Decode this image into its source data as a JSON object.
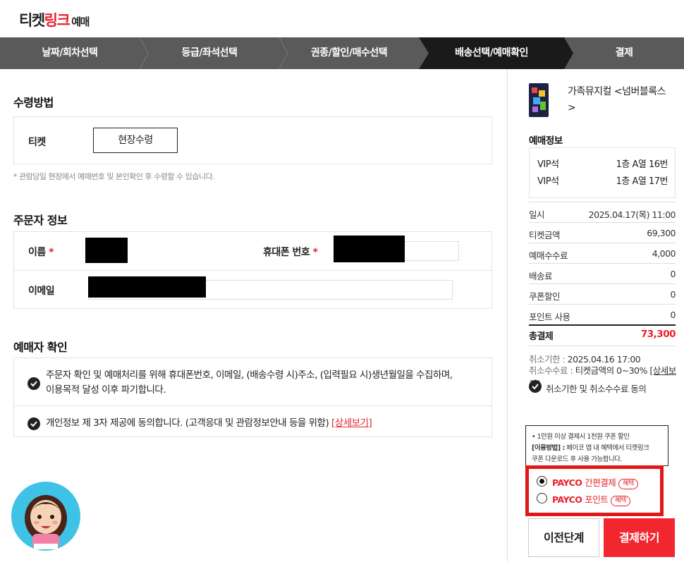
{
  "header": {
    "logo_part1": "티켓",
    "logo_part2": "링크",
    "logo_part3": "예매"
  },
  "steps": [
    {
      "label": "날짜/회차선택"
    },
    {
      "label": "등급/좌석선택"
    },
    {
      "label": "권종/할인/매수선택"
    },
    {
      "label": "배송선택/예매확인",
      "active": true
    },
    {
      "label": "결제"
    }
  ],
  "delivery": {
    "title": "수령방법",
    "ticket_label": "티켓",
    "option": "현장수령",
    "note": "* 관람당일 현장에서 예매번호 및 본인확인 후 수령할 수 있습니다."
  },
  "orderer": {
    "title": "주문자 정보",
    "name_label": "이름",
    "phone_label": "휴대폰 번호",
    "email_label": "이메일",
    "required_mark": "*"
  },
  "confirm": {
    "title": "예매자 확인",
    "item1_line1": "주문자 확인 및 예매처리를 위해 휴대폰번호, 이메일, (배송수령 시)주소, (입력필요 시)생년월일을 수집하며,",
    "item1_line2": "이용목적 달성 이후 파기합니다.",
    "item2_text": "개인정보 제 3자 제공에 동의합니다. (고객응대 및 관람정보안내 등을 위함)",
    "item2_link": "[상세보기]"
  },
  "summary": {
    "show_title": "가족뮤지컬 <넘버블록스>",
    "booking_info_title": "예매정보",
    "seats": [
      {
        "grade": "VIP석",
        "seat": "1층 A열 16번"
      },
      {
        "grade": "VIP석",
        "seat": "1층 A열 17번"
      }
    ],
    "rows": [
      {
        "label": "일시",
        "value": "2025.04.17(목) 11:00"
      },
      {
        "label": "티켓금액",
        "value": "69,300"
      },
      {
        "label": "예매수수료",
        "value": "4,000"
      },
      {
        "label": "배송료",
        "value": "0"
      },
      {
        "label": "쿠폰할인",
        "value": "0"
      },
      {
        "label": "포인트 사용",
        "value": "0"
      }
    ],
    "total_label": "총결제",
    "total_value": "73,300",
    "cancel_deadline_label": "취소기한 : ",
    "cancel_deadline_value": "2025.04.16 17:00",
    "cancel_fee_label": "취소수수료 : ",
    "cancel_fee_value": "티켓금액의 0~30%",
    "cancel_fee_link": "[상세보기]",
    "agree_label": "취소기한 및 취소수수료 동의"
  },
  "tooltip": {
    "line1": "• 1만원 이상 결제시 1천원 쿠폰 할인",
    "line2_bold": "[이용방법] :",
    "line2": " 페이코 앱 내 혜택에서 티켓링크",
    "line3": "쿠폰 다운로드 후 사용 가능합니다."
  },
  "payment": {
    "option1_brand": "PAYCO",
    "option1_label": "간편결제",
    "option2_brand": "PAYCO",
    "option2_label": "포인트",
    "badge": "혜택"
  },
  "buttons": {
    "prev": "이전단계",
    "pay": "결제하기"
  },
  "colors": {
    "accent": "#e8212d",
    "step_bar": "#5a5a5a",
    "step_active": "#1a1a1a",
    "highlight_border": "#e01818"
  }
}
